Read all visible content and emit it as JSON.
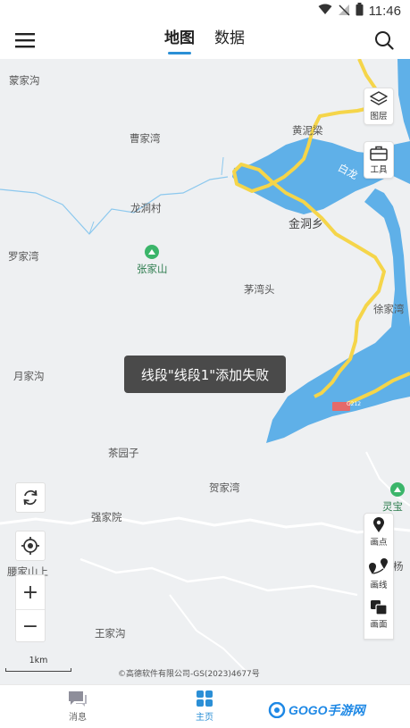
{
  "status": {
    "time": "11:46"
  },
  "header": {
    "tabs": [
      {
        "label": "地图"
      },
      {
        "label": "数据"
      }
    ]
  },
  "map": {
    "places": [
      {
        "name": "蒙家沟"
      },
      {
        "name": "曹家湾"
      },
      {
        "name": "黄泥梁"
      },
      {
        "name": "龙洞村"
      },
      {
        "name": "金洞乡"
      },
      {
        "name": "罗家湾"
      },
      {
        "name": "张家山"
      },
      {
        "name": "茅湾头"
      },
      {
        "name": "徐家湾"
      },
      {
        "name": "月家沟"
      },
      {
        "name": "茶园子"
      },
      {
        "name": "贺家湾"
      },
      {
        "name": "强家院"
      },
      {
        "name": "腰家山上"
      },
      {
        "name": "王家沟"
      },
      {
        "name": "灵宝"
      },
      {
        "name": "白龙"
      },
      {
        "name": "杨"
      }
    ],
    "road_badge": "G212",
    "scale_label": "1km",
    "copyright": "©高德软件有限公司-GS(2023)4677号"
  },
  "right_tools": {
    "layers": "图层",
    "tools": "工具",
    "draw_point": "画点",
    "draw_line": "画线",
    "draw_area": "画面"
  },
  "toast": {
    "message": "线段\"线段1\"添加失败"
  },
  "bottom_nav": {
    "messages": "消息",
    "home": "主页"
  },
  "watermark": {
    "text": "GOGO手游网"
  },
  "colors": {
    "accent": "#2b8fd6",
    "water": "#5fb0e8",
    "road": "#f5d54a",
    "poi": "#3bb56a"
  }
}
